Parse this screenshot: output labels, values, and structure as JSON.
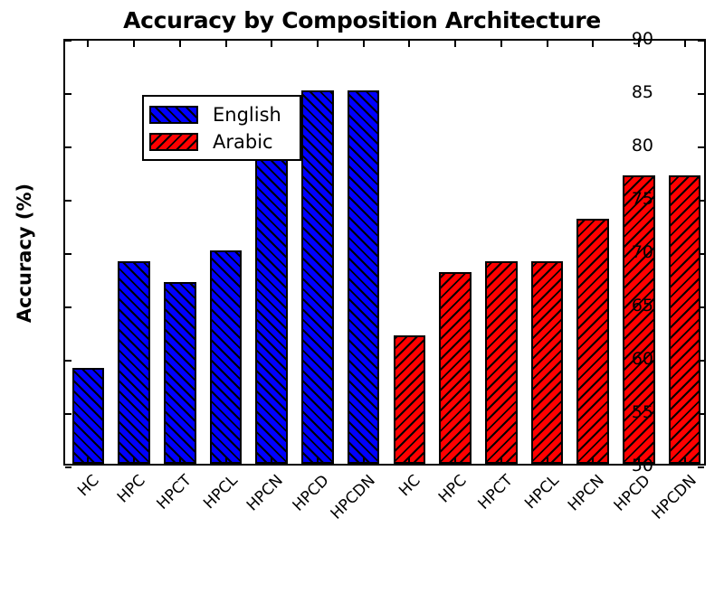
{
  "chart_data": {
    "type": "bar",
    "title": "Accuracy by Composition Architecture",
    "xlabel": "",
    "ylabel": "Accuracy (%)",
    "ylim": [
      50,
      90
    ],
    "ytick_labels": [
      "50",
      "55",
      "60",
      "65",
      "70",
      "75",
      "80",
      "85",
      "90"
    ],
    "ytick_values": [
      50,
      55,
      60,
      65,
      70,
      75,
      80,
      85,
      90
    ],
    "grid": false,
    "legend_position": "upper left",
    "categories": [
      "HC",
      "HPC",
      "HPCT",
      "HPCL",
      "HPCN",
      "HPCD",
      "HPCDN",
      "HC",
      "HPC",
      "HPCT",
      "HPCL",
      "HPCN",
      "HPCD",
      "HPCDN"
    ],
    "series": [
      {
        "name": "English",
        "color": "#0000ff",
        "hatch": "/",
        "categories": [
          "HC",
          "HPC",
          "HPCT",
          "HPCL",
          "HPCN",
          "HPCD",
          "HPCDN"
        ],
        "values": [
          59,
          69,
          67,
          70,
          79,
          85,
          85
        ]
      },
      {
        "name": "Arabic",
        "color": "#ff0000",
        "hatch": "\\",
        "categories": [
          "HC",
          "HPC",
          "HPCT",
          "HPCL",
          "HPCN",
          "HPCD",
          "HPCDN"
        ],
        "values": [
          62,
          68,
          69,
          69,
          73,
          77,
          77
        ]
      }
    ],
    "bars": [
      {
        "label": "HC",
        "value": 59,
        "series": "English"
      },
      {
        "label": "HPC",
        "value": 69,
        "series": "English"
      },
      {
        "label": "HPCT",
        "value": 67,
        "series": "English"
      },
      {
        "label": "HPCL",
        "value": 70,
        "series": "English"
      },
      {
        "label": "HPCN",
        "value": 79,
        "series": "English"
      },
      {
        "label": "HPCD",
        "value": 85,
        "series": "English"
      },
      {
        "label": "HPCDN",
        "value": 85,
        "series": "English"
      },
      {
        "label": "HC",
        "value": 62,
        "series": "Arabic"
      },
      {
        "label": "HPC",
        "value": 68,
        "series": "Arabic"
      },
      {
        "label": "HPCT",
        "value": 69,
        "series": "Arabic"
      },
      {
        "label": "HPCL",
        "value": 69,
        "series": "Arabic"
      },
      {
        "label": "HPCN",
        "value": 73,
        "series": "Arabic"
      },
      {
        "label": "HPCD",
        "value": 77,
        "series": "Arabic"
      },
      {
        "label": "HPCDN",
        "value": 77,
        "series": "Arabic"
      }
    ]
  },
  "legend": {
    "entries": [
      {
        "label": "English",
        "swatch": "en"
      },
      {
        "label": "Arabic",
        "swatch": "ar"
      }
    ]
  }
}
